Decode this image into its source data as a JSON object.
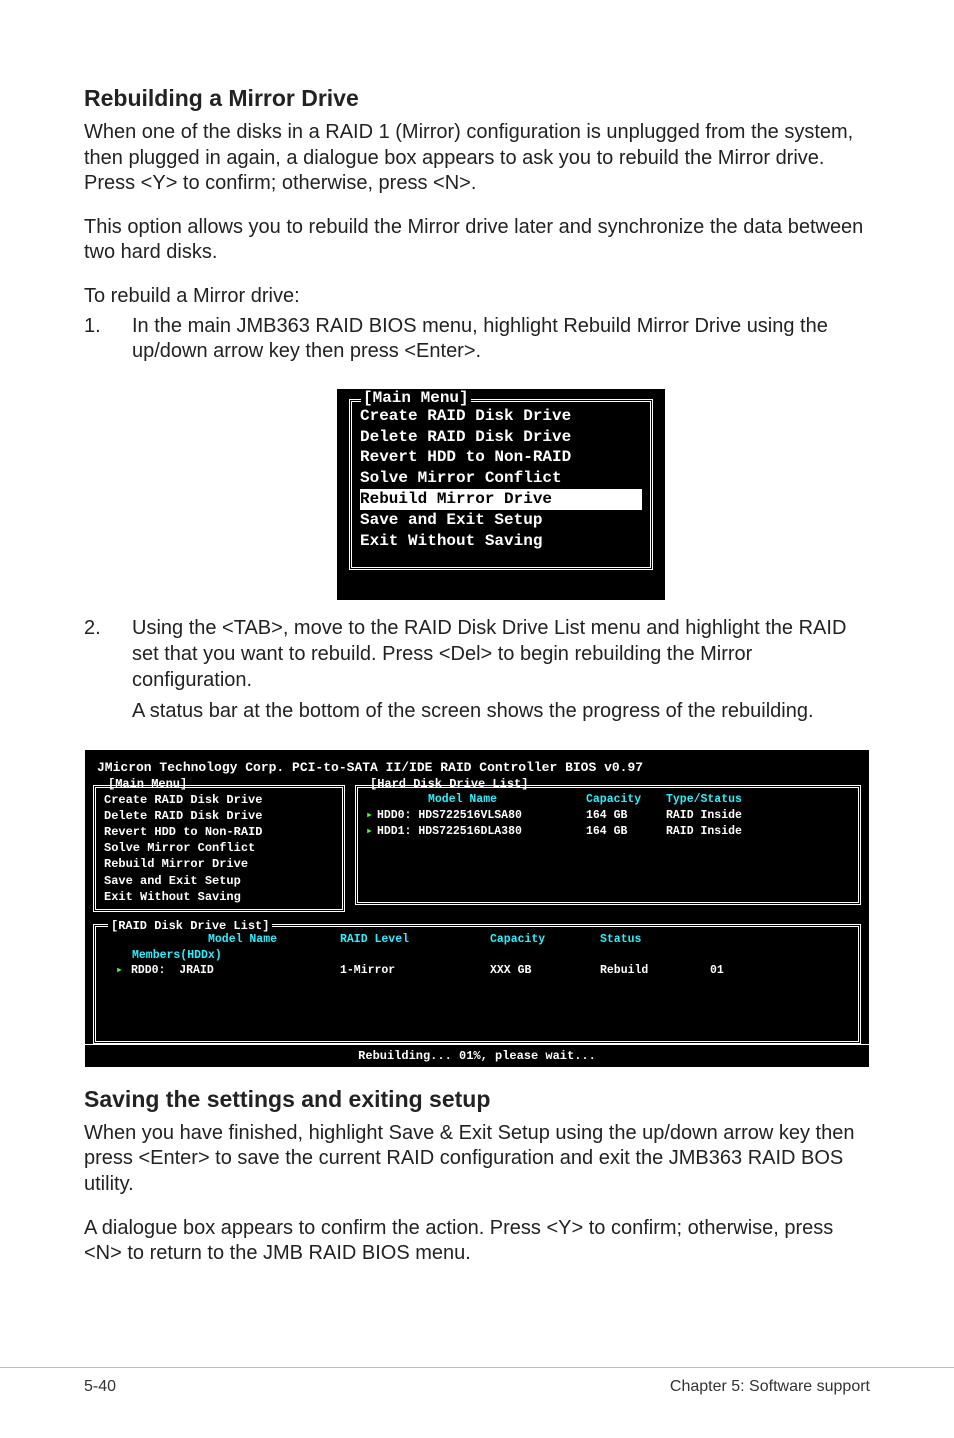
{
  "section1_title": "Rebuilding a Mirror Drive",
  "p1": "When one of the disks in a RAID 1 (Mirror) configuration is unplugged from the system, then plugged in again, a dialogue box appears to ask you to rebuild the Mirror drive. Press <Y> to confirm; otherwise, press <N>.",
  "p2": "This option allows you to rebuild the Mirror drive later and synchronize the data between two hard disks.",
  "p3": "To rebuild a Mirror drive:",
  "steps": [
    {
      "num": "1.",
      "text": "In the main JMB363 RAID BIOS menu, highlight Rebuild Mirror Drive using the up/down arrow key then press <Enter>."
    },
    {
      "num": "2.",
      "text": "Using the <TAB>, move to the RAID Disk Drive List menu and highlight the RAID set that you want to rebuild. Press <Del> to begin rebuilding the Mirror configuration.",
      "extra": "A status bar at the bottom of the screen shows the progress of the rebuilding."
    }
  ],
  "small_bios": {
    "title": "[Main Menu]",
    "items": [
      "Create RAID Disk Drive",
      "Delete RAID Disk Drive",
      "Revert HDD to Non-RAID",
      "Solve Mirror Conflict",
      "Rebuild Mirror Drive",
      "Save and Exit Setup",
      "Exit Without Saving"
    ],
    "selected_index": 4
  },
  "large_bios": {
    "header": "JMicron Technology Corp. PCI-to-SATA II/IDE RAID Controller BIOS v0.97",
    "main_title": "[Main Menu]",
    "main_items": [
      "Create RAID Disk Drive",
      "Delete RAID Disk Drive",
      "Revert HDD to Non-RAID",
      "Solve Mirror Conflict",
      "Rebuild Mirror Drive",
      "Save and Exit Setup",
      "Exit Without Saving"
    ],
    "hdd_title": "[Hard Disk Drive List]",
    "hdd_cols": {
      "model": "Model Name",
      "cap": "Capacity",
      "type": "Type/Status"
    },
    "hdd_rows": [
      {
        "prefix": "HDD0:",
        "model": "HDS722516VLSA80",
        "cap": "164 GB",
        "type": "RAID Inside"
      },
      {
        "prefix": "HDD1:",
        "model": "HDS722516DLA380",
        "cap": "164 GB",
        "type": "RAID Inside"
      }
    ],
    "raid_title": "[RAID Disk Drive List]",
    "raid_cols": {
      "name": "Model Name",
      "lvl": "RAID Level",
      "cap": "Capacity",
      "stat": "Status"
    },
    "members_label": "Members(HDDx)",
    "raid_row": {
      "name": "RDD0:  JRAID",
      "lvl": "1-Mirror",
      "cap": "XXX GB",
      "stat": "Rebuild",
      "num": "01"
    },
    "status": "Rebuilding... 01%, please wait..."
  },
  "section2_title": "Saving the settings and exiting setup",
  "p4": "When you have finished, highlight Save & Exit Setup using the up/down arrow key then press <Enter> to save the current RAID configuration and exit the JMB363 RAID BOS utility.",
  "p5": "A dialogue box appears to confirm the action. Press <Y> to confirm; otherwise, press <N> to return to the JMB RAID BIOS menu.",
  "footer": {
    "left": "5-40",
    "right": "Chapter 5: Software support"
  }
}
